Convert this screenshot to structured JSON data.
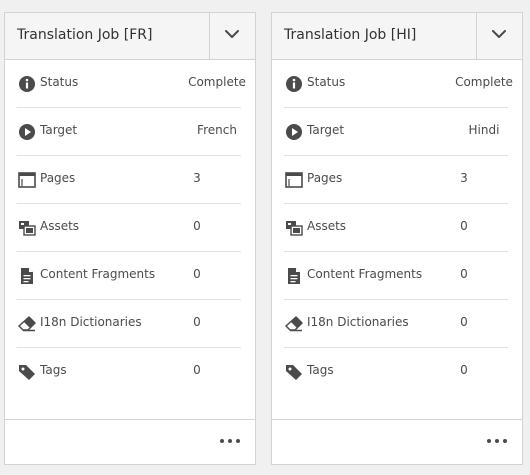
{
  "cards": [
    {
      "title": "Translation Job [FR]",
      "rows": [
        {
          "icon": "info-icon",
          "label": "Status",
          "value": "Complete"
        },
        {
          "icon": "play-circle-icon",
          "label": "Target",
          "value": "French"
        },
        {
          "icon": "pages-icon",
          "label": "Pages",
          "value": "3"
        },
        {
          "icon": "assets-icon",
          "label": "Assets",
          "value": "0"
        },
        {
          "icon": "document-icon",
          "label": "Content Fragments",
          "value": "0"
        },
        {
          "icon": "eraser-icon",
          "label": "I18n Dictionaries",
          "value": "0"
        },
        {
          "icon": "tag-icon",
          "label": "Tags",
          "value": "0"
        }
      ]
    },
    {
      "title": "Translation Job [HI]",
      "rows": [
        {
          "icon": "info-icon",
          "label": "Status",
          "value": "Complete"
        },
        {
          "icon": "play-circle-icon",
          "label": "Target",
          "value": "Hindi"
        },
        {
          "icon": "pages-icon",
          "label": "Pages",
          "value": "3"
        },
        {
          "icon": "assets-icon",
          "label": "Assets",
          "value": "0"
        },
        {
          "icon": "document-icon",
          "label": "Content Fragments",
          "value": "0"
        },
        {
          "icon": "eraser-icon",
          "label": "I18n Dictionaries",
          "value": "0"
        },
        {
          "icon": "tag-icon",
          "label": "Tags",
          "value": "0"
        }
      ]
    }
  ]
}
